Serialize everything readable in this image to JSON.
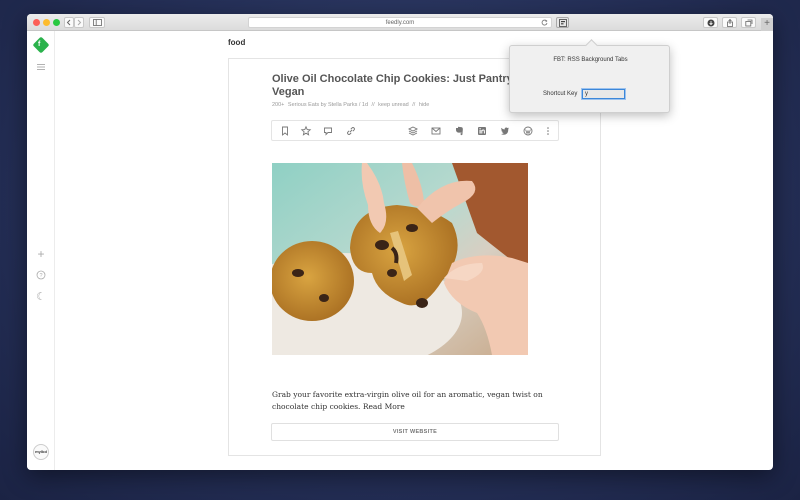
{
  "browser": {
    "url": "feedly.com",
    "new_tab_label": "+"
  },
  "sidebar": {
    "logo_glyph": "f",
    "add_icon": "+",
    "help_icon": "?",
    "night_icon": "☾",
    "avatar_label": "mylbd"
  },
  "main": {
    "feed_title": "food",
    "article": {
      "title": "Olive Oil Chocolate Chip Cookies: Just Pantry Totally Vegan",
      "meta_count": "200+",
      "meta_source": "Serious Eats by Stella Parks / 1d",
      "meta_sep1": "//",
      "keep_unread": "keep unread",
      "meta_sep2": "//",
      "hide": "hide",
      "summary_text": "Grab your favorite extra-virgin olive oil for an aromatic, vegan twist on chocolate chip cookies.",
      "read_more": "Read More",
      "visit_label": "VISIT WEBSITE"
    }
  },
  "popover": {
    "title": "FBT: RSS Background Tabs",
    "shortcut_label": "Shortcut Key",
    "shortcut_value": "y"
  },
  "colors": {
    "feedly_green": "#2bb24c",
    "focus_blue": "#3c87d9"
  }
}
